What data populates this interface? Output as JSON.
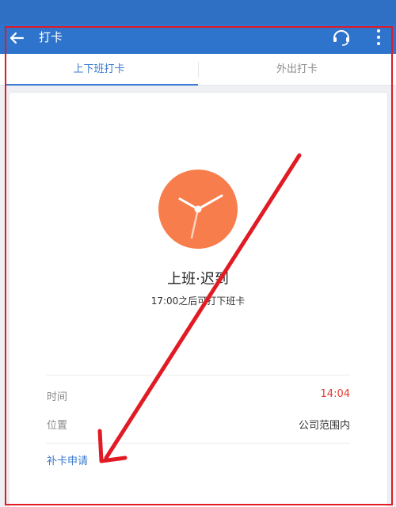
{
  "appbar": {
    "title": "打卡",
    "back_icon": "arrow-left-icon",
    "support_icon": "headset-icon",
    "more_icon": "more-vertical-icon"
  },
  "tabs": [
    {
      "label": "上下班打卡",
      "active": true
    },
    {
      "label": "外出打卡",
      "active": false
    }
  ],
  "status": {
    "clock_icon": "clock-icon",
    "title": "上班·迟到",
    "subtitle": "17:00之后可打下班卡"
  },
  "details": {
    "time_label": "时间",
    "time_value": "14:04",
    "location_label": "位置",
    "location_value": "公司范围内"
  },
  "makeup_link": "补卡申请",
  "colors": {
    "header": "#2e73cc",
    "accent": "#3b7bd1",
    "clock": "#f77e4c",
    "late_time": "#e03b2f",
    "annotation": "#e11b24"
  }
}
